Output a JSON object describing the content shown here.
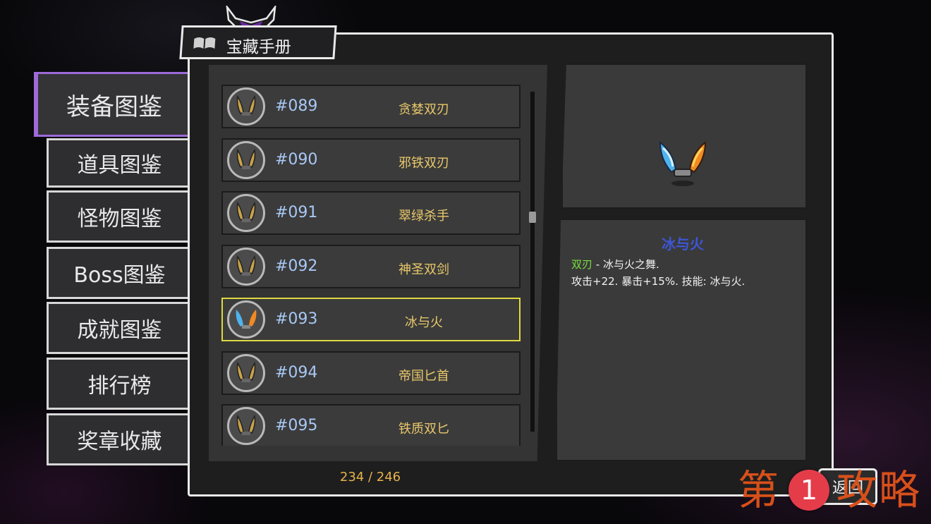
{
  "window": {
    "title": "宝藏手册"
  },
  "sidebar": {
    "items": [
      {
        "label": "装备图鉴",
        "active": true
      },
      {
        "label": "道具图鉴",
        "active": false
      },
      {
        "label": "怪物图鉴",
        "active": false
      },
      {
        "label": "Boss图鉴",
        "active": false
      },
      {
        "label": "成就图鉴",
        "active": false
      },
      {
        "label": "排行榜",
        "active": false
      },
      {
        "label": "奖章收藏",
        "active": false
      }
    ]
  },
  "list": {
    "rows": [
      {
        "id": "#089",
        "name": "贪婪双刃",
        "icon": "twin-blade-gold-icon",
        "selected": false
      },
      {
        "id": "#090",
        "name": "邪铁双刃",
        "icon": "twin-blade-iron-icon",
        "selected": false
      },
      {
        "id": "#091",
        "name": "翠绿杀手",
        "icon": "twin-blade-dark-icon",
        "selected": false
      },
      {
        "id": "#092",
        "name": "神圣双剑",
        "icon": "twin-sword-holy-icon",
        "selected": false
      },
      {
        "id": "#093",
        "name": "冰与火",
        "icon": "twin-blade-ice-fire-icon",
        "selected": true
      },
      {
        "id": "#094",
        "name": "帝国匕首",
        "icon": "twin-dagger-imperial-icon",
        "selected": false
      },
      {
        "id": "#095",
        "name": "铁质双匕",
        "icon": "twin-dagger-iron-icon",
        "selected": false
      }
    ],
    "counter": "234 / 246"
  },
  "detail": {
    "title": "冰与火",
    "type_tag": "双刃",
    "description": " - 冰与火之舞.",
    "stats": "攻击+22. 暴击+15%. 技能: 冰与火.",
    "icon": "ice-fire-blades-icon"
  },
  "buttons": {
    "back_label": "返回"
  },
  "watermark": {
    "text_left": "第",
    "badge": "1",
    "text_right": "攻略"
  },
  "colors": {
    "accent_active": "#9d6ad9",
    "selected_border": "#e0d940",
    "item_number": "#a9c8f5",
    "item_name": "#e8c86a",
    "detail_title": "#3d56d6",
    "type_tag": "#79e03d",
    "counter": "#e8b24a"
  }
}
